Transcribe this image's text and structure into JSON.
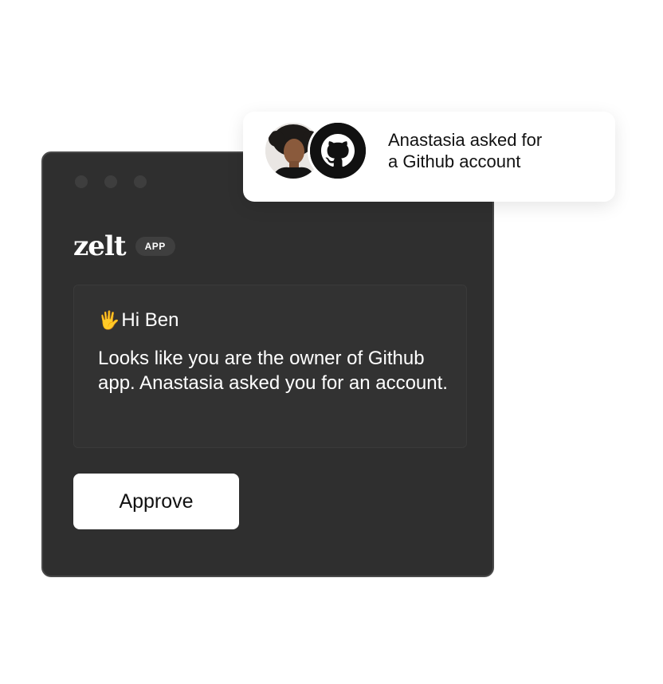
{
  "window": {
    "logo_text": "zelt",
    "app_badge": "APP",
    "message": {
      "greeting_emoji": "🖐",
      "greeting": "Hi Ben",
      "body": "Looks like you are the owner of Github app. Anastasia asked you for an account."
    },
    "approve_label": "Approve"
  },
  "notification": {
    "text_line1": "Anastasia asked for",
    "text_line2": "a Github account",
    "avatar_icon": "user-avatar-photo",
    "app_icon": "github-icon"
  },
  "colors": {
    "window_bg": "#2f2f2f",
    "card_bg": "#323232",
    "button_bg": "#ffffff",
    "text_dark": "#111111",
    "text_light": "#ffffff"
  }
}
